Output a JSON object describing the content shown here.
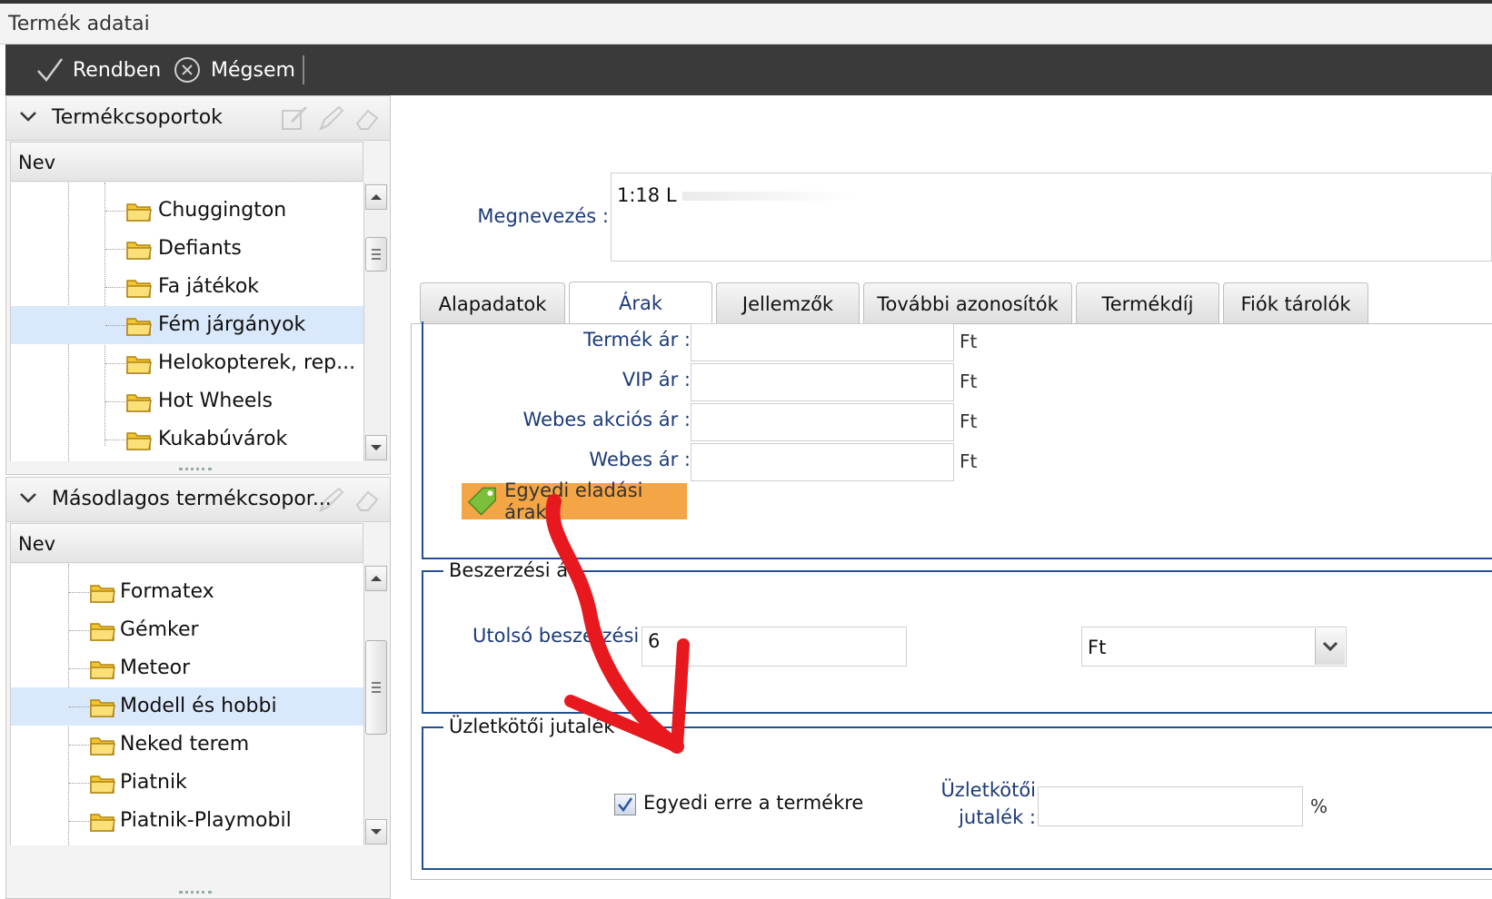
{
  "window": {
    "title": "Termék adatai"
  },
  "toolbar": {
    "ok_label": "Rendben",
    "cancel_label": "Mégsem"
  },
  "groups_panel": {
    "title": "Termékcsoportok",
    "column": "Nev",
    "items": [
      {
        "label": "Chuggington",
        "selected": false
      },
      {
        "label": "Defiants",
        "selected": false
      },
      {
        "label": "Fa játékok",
        "selected": false
      },
      {
        "label": "Fém járgányok",
        "selected": true
      },
      {
        "label": "Helokopterek, rep...",
        "selected": false
      },
      {
        "label": "Hot Wheels",
        "selected": false
      },
      {
        "label": "Kukabúvárok",
        "selected": false
      }
    ]
  },
  "secondary_panel": {
    "title": "Másodlagos termékcsopor...",
    "column": "Nev",
    "items": [
      {
        "label": "Formatex",
        "selected": false
      },
      {
        "label": "Gémker",
        "selected": false
      },
      {
        "label": "Meteor",
        "selected": false
      },
      {
        "label": "Modell és hobbi",
        "selected": true
      },
      {
        "label": "Neked terem",
        "selected": false
      },
      {
        "label": "Piatnik",
        "selected": false
      },
      {
        "label": "Piatnik-Playmobil",
        "selected": false
      }
    ]
  },
  "name_field": {
    "label": "Megnevezés :",
    "value": "1:18 L"
  },
  "tabs": [
    {
      "label": "Alapadatok",
      "active": false
    },
    {
      "label": "Árak",
      "active": true
    },
    {
      "label": "Jellemzők",
      "active": false
    },
    {
      "label": "További azonosítók",
      "active": false
    },
    {
      "label": "Termékdíj",
      "active": false
    },
    {
      "label": "Fiók tárolók",
      "active": false
    }
  ],
  "prices": {
    "rows": [
      {
        "label": "Termék ár :",
        "value": "",
        "unit": "Ft"
      },
      {
        "label": "VIP ár :",
        "value": "",
        "unit": "Ft"
      },
      {
        "label": "Webes akciós ár :",
        "value": "",
        "unit": "Ft"
      },
      {
        "label": "Webes ár :",
        "value": "",
        "unit": "Ft"
      }
    ],
    "custom_button": "Egyedi eladási árak"
  },
  "purchase": {
    "legend": "Beszerzési ár",
    "last_label": "Utolsó beszerzési ár :",
    "last_value": "6",
    "currency": "Ft"
  },
  "commission": {
    "legend": "Üzletkötői jutalék",
    "checkbox_label": "Egyedi erre a termékre",
    "checked": true,
    "field_label_1": "Üzletkötői",
    "field_label_2": "jutalék :",
    "value": "",
    "unit": "%"
  },
  "colors": {
    "toolbar": "#3a3a3a",
    "label_blue": "#1c3a78",
    "fieldset_blue": "#24508f",
    "selection": "#d9e8fb",
    "orange_button": "#f4a545",
    "annotation_red": "#e8191e"
  }
}
